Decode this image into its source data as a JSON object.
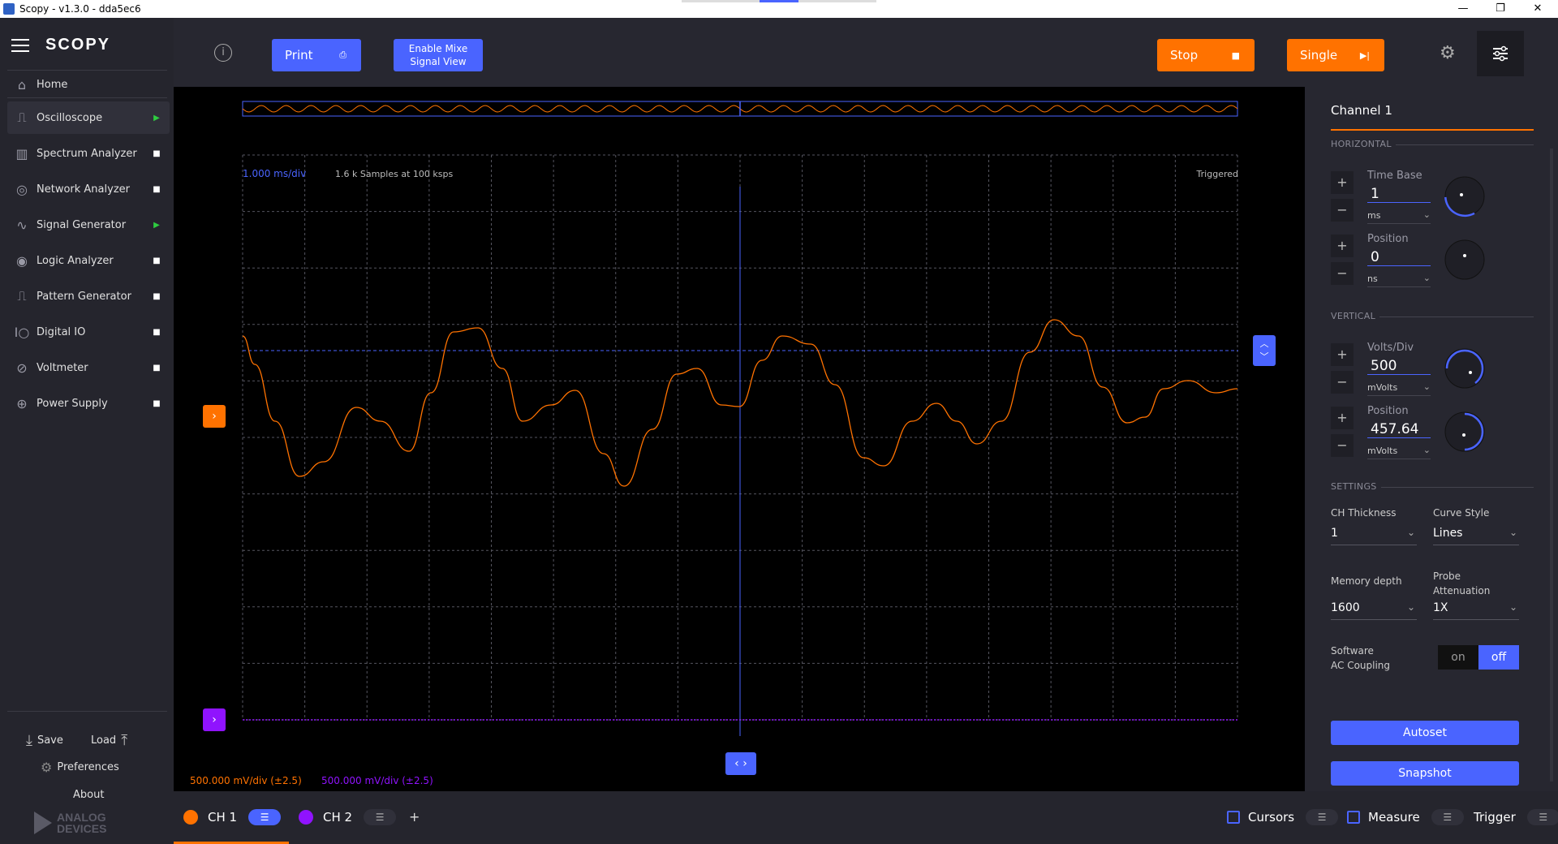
{
  "window": {
    "title": "Scopy - v1.3.0 - dda5ec6",
    "min": "—",
    "max": "❐",
    "close": "✕"
  },
  "sidebar": {
    "logo": "SCOPY",
    "home": "Home",
    "items": [
      {
        "label": "Oscilloscope",
        "icon": "oscilloscope-icon",
        "glyph": "⎍",
        "status": "▶"
      },
      {
        "label": "Spectrum Analyzer",
        "icon": "spectrum-icon",
        "glyph": "▥",
        "status": "■"
      },
      {
        "label": "Network Analyzer",
        "icon": "network-icon",
        "glyph": "◎",
        "status": "■"
      },
      {
        "label": "Signal Generator",
        "icon": "signal-icon",
        "glyph": "∿",
        "status": "▶"
      },
      {
        "label": "Logic Analyzer",
        "icon": "logic-icon",
        "glyph": "◉",
        "status": "■"
      },
      {
        "label": "Pattern Generator",
        "icon": "pattern-icon",
        "glyph": "⎍",
        "status": "■"
      },
      {
        "label": "Digital IO",
        "icon": "digital-io-icon",
        "glyph": "Ⅰ○",
        "status": "■"
      },
      {
        "label": "Voltmeter",
        "icon": "voltmeter-icon",
        "glyph": "⊘",
        "status": "■"
      },
      {
        "label": "Power Supply",
        "icon": "power-icon",
        "glyph": "⊕",
        "status": "■"
      }
    ],
    "save": "Save",
    "load": "Load",
    "preferences": "Preferences",
    "about": "About",
    "brand_line1": "ANALOG",
    "brand_line2": "DEVICES"
  },
  "toolbar": {
    "print": "Print",
    "mixed": "Enable Mixe\nSignal View",
    "mixed_l1": "Enable Mixe",
    "mixed_l2": "Signal View",
    "stop": "Stop",
    "single": "Single",
    "info_icon": "ⓘ"
  },
  "plot": {
    "timebase": "1.000 ms/div",
    "samples": "1.6 k Samples at 100 ksps",
    "status": "Triggered",
    "ch1_scale": "500.000 mV/div (±2.5)",
    "ch2_scale": "500.000 mV/div (±2.5)"
  },
  "panel": {
    "title": "Channel 1",
    "horizontal": "HORIZONTAL",
    "vertical": "VERTICAL",
    "settings": "SETTINGS",
    "timebase_label": "Time Base",
    "timebase_value": "1",
    "timebase_unit": "ms",
    "hpos_label": "Position",
    "hpos_value": "0",
    "hpos_unit": "ns",
    "voltsdiv_label": "Volts/Div",
    "voltsdiv_value": "500",
    "voltsdiv_unit": "mVolts",
    "vpos_label": "Position",
    "vpos_value": "457.64",
    "vpos_unit": "mVolts",
    "thickness_label": "CH Thickness",
    "thickness_value": "1",
    "curve_label": "Curve Style",
    "curve_value": "Lines",
    "memory_label": "Memory depth",
    "memory_value": "1600",
    "probe_label_1": "Probe",
    "probe_label_2": "Attenuation",
    "probe_value": "1X",
    "ac_label_1": "Software",
    "ac_label_2": "AC Coupling",
    "on": "on",
    "off": "off",
    "autoset": "Autoset",
    "snapshot": "Snapshot"
  },
  "bottom": {
    "ch1": "CH 1",
    "ch2": "CH 2",
    "add": "+",
    "cursors": "Cursors",
    "measure": "Measure",
    "trigger": "Trigger"
  },
  "colors": {
    "accent": "#4a64ff",
    "ch1": "#ff7200",
    "ch2": "#9013fe",
    "run": "#2ecc40"
  }
}
